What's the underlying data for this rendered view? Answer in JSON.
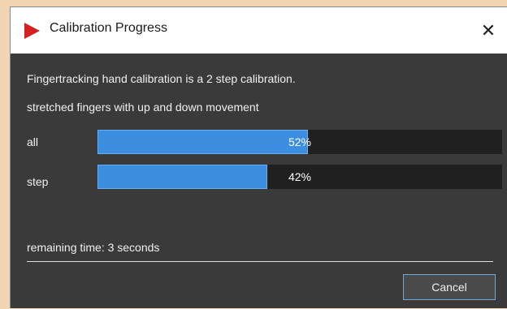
{
  "window": {
    "title": "Calibration Progress",
    "app_icon": "red-play-triangle-icon",
    "close_glyph": "✕",
    "close_icon": "close-icon"
  },
  "content": {
    "description": "Fingertracking hand calibration is a 2 step calibration.",
    "current_step": "stretched fingers with up and down movement",
    "progress": [
      {
        "label": "all",
        "value": 52,
        "text": "52%"
      },
      {
        "label": "step",
        "value": 42,
        "text": "42%"
      }
    ],
    "remaining": "remaining time: 3 seconds"
  },
  "buttons": {
    "cancel_label": "Cancel"
  },
  "colors": {
    "accent": "#3b8ee0",
    "dialog_bg": "#3a3a3a",
    "track_bg": "#202020",
    "icon_red": "#d42020"
  }
}
